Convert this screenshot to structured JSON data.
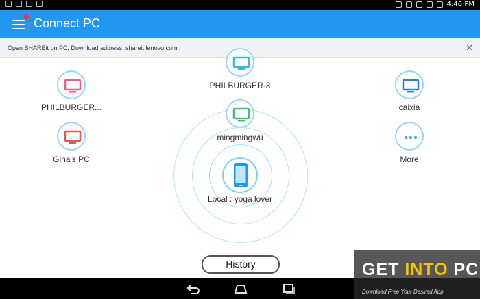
{
  "status_bar": {
    "time": "4:46",
    "ampm": "PM"
  },
  "app_bar": {
    "title": "Connect PC",
    "menu_icon": "hamburger-menu-icon",
    "accent": "#2196f3",
    "notification_dot_color": "#e53935"
  },
  "banner": {
    "text": "Open SHAREit on PC, Download address: shareit.lenovo.com",
    "close_glyph": "✕"
  },
  "devices": [
    {
      "name": "PHILBURGER...",
      "icon": "monitor-icon",
      "color": "#e85d8c"
    },
    {
      "name": "Gina's PC",
      "icon": "monitor-icon",
      "color": "#e05b5b"
    },
    {
      "name": "PHILBURGER-3",
      "icon": "monitor-icon",
      "color": "#3ab9dd"
    },
    {
      "name": "mingmingwu",
      "icon": "monitor-icon",
      "color": "#3cc07a"
    },
    {
      "name": "caixia",
      "icon": "monitor-icon",
      "color": "#2f7fd6"
    },
    {
      "name": "More",
      "icon": "more-dots-icon",
      "color": "#2fa8e0"
    }
  ],
  "local": {
    "label": "Local  :  yoga lover",
    "icon": "phone-icon",
    "color": "#2196f3"
  },
  "history_button": {
    "label": "History"
  },
  "watermark": {
    "get": "GET ",
    "into": "INTO",
    "pc": " PC",
    "sub": "Download Free Your Desired App"
  }
}
